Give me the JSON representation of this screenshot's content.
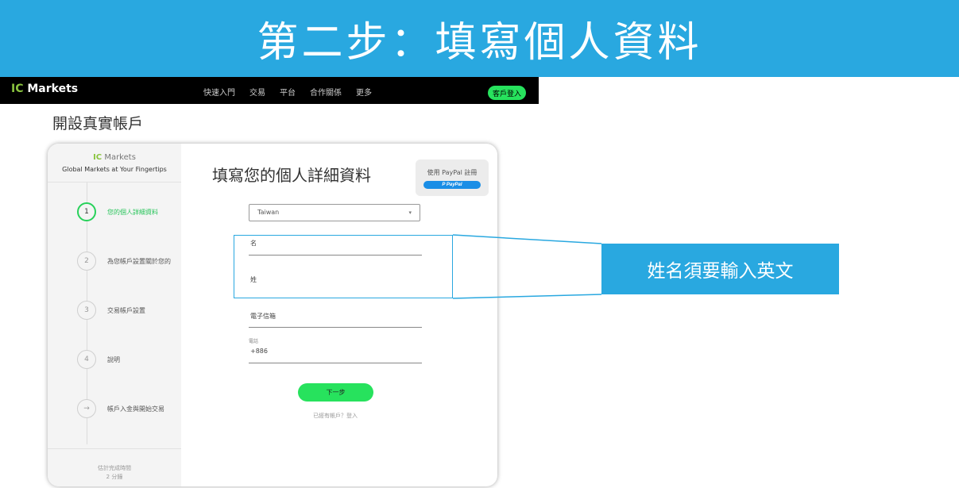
{
  "banner": {
    "title": "第二步：填寫個人資料"
  },
  "navbar": {
    "logo_ic": "IC",
    "logo_rest": " Markets",
    "items": [
      "快速入門",
      "交易",
      "平台",
      "合作關係",
      "更多"
    ],
    "login": "客戶登入"
  },
  "page": {
    "heading": "開設真實帳戶"
  },
  "sidebar": {
    "logo_ic": "IC",
    "logo_rest": " Markets",
    "tagline": "Global Markets at Your Fingertips",
    "steps": [
      {
        "number": "1",
        "label": "您的個人詳細資料",
        "active": true
      },
      {
        "number": "2",
        "label": "為您帳戶設置關於您的",
        "active": false
      },
      {
        "number": "3",
        "label": "交易帳戶設置",
        "active": false
      },
      {
        "number": "4",
        "label": "說明",
        "active": false
      },
      {
        "number": "→",
        "label": "帳戶入金與開始交易",
        "active": false
      }
    ],
    "footer_line1": "估計完成時間",
    "footer_line2": "2 分鐘"
  },
  "form": {
    "title": "填寫您的個人詳細資料",
    "paypal_text": "使用 PayPal 註冊",
    "paypal_button": "P PayPal",
    "country": "Taiwan",
    "country_arrow": "▾",
    "first_name": "名",
    "last_name": "姓",
    "email": "電子信箱",
    "phone_label": "電話",
    "phone_value": "+886",
    "next": "下一步",
    "login_link": "已經有帳戶？登入"
  },
  "callout": {
    "text": "姓名須要輸入英文"
  },
  "colors": {
    "accent_blue": "#29a8e0",
    "brand_green": "#27e25d",
    "active_green": "#27c45a"
  }
}
